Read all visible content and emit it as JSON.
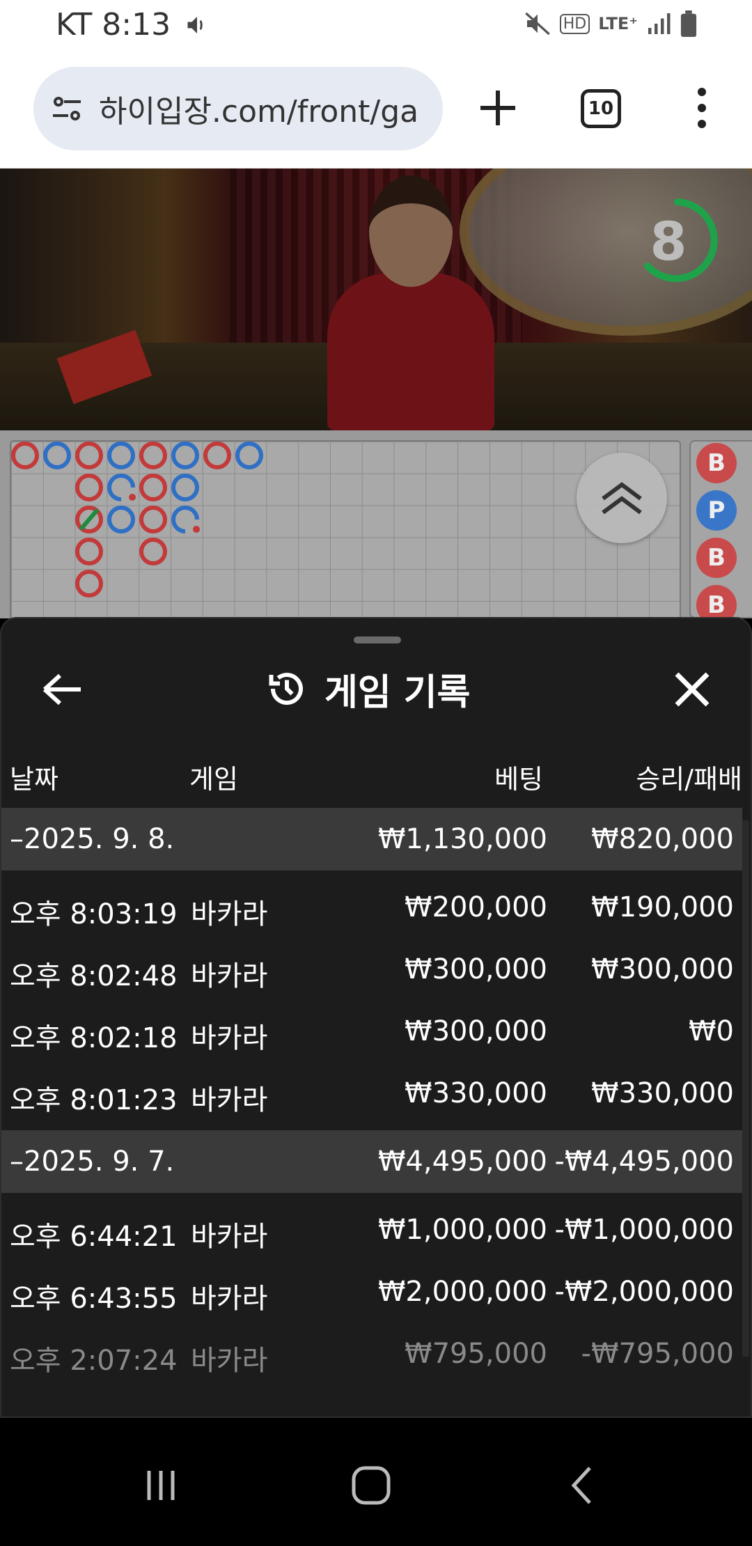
{
  "status_bar": {
    "carrier_time": "KT 8:13",
    "icons": [
      "volume-icon",
      "mute-icon",
      "hd-icon",
      "lte-icon",
      "signal-icon",
      "battery-icon"
    ],
    "network": "LTE⁺",
    "hd": "HD"
  },
  "browser": {
    "url": "하이입장.com/front/ga",
    "tab_count": "10"
  },
  "video": {
    "countdown": "8",
    "timer_color": "#1fa34a"
  },
  "roadmap": {
    "colors": {
      "banker": "#c23a3a",
      "player": "#2f6fc4",
      "tie": "#1e8a3c"
    },
    "side_beads": [
      {
        "label": "B",
        "color": "#c94a4a"
      },
      {
        "label": "P",
        "color": "#3a76c8"
      },
      {
        "label": "B",
        "color": "#c94a4a"
      },
      {
        "label": "B",
        "color": "#c94a4a"
      }
    ]
  },
  "sheet": {
    "title": "게임 기록",
    "columns": {
      "date": "날짜",
      "game": "게임",
      "bet": "베팅",
      "win_loss": "승리/패배"
    },
    "groups": [
      {
        "date": "–2025. 9. 8.",
        "bet": "₩1,130,000",
        "win_loss": "₩820,000",
        "rows": [
          {
            "time": "오후 8:03:19",
            "game": "바카라",
            "bet": "₩200,000",
            "win_loss": "₩190,000"
          },
          {
            "time": "오후 8:02:48",
            "game": "바카라",
            "bet": "₩300,000",
            "win_loss": "₩300,000"
          },
          {
            "time": "오후 8:02:18",
            "game": "바카라",
            "bet": "₩300,000",
            "win_loss": "₩0"
          },
          {
            "time": "오후 8:01:23",
            "game": "바카라",
            "bet": "₩330,000",
            "win_loss": "₩330,000"
          }
        ]
      },
      {
        "date": "–2025. 9. 7.",
        "bet": "₩4,495,000",
        "win_loss": "-₩4,495,000",
        "rows": [
          {
            "time": "오후 6:44:21",
            "game": "바카라",
            "bet": "₩1,000,000",
            "win_loss": "-₩1,000,000"
          },
          {
            "time": "오후 6:43:55",
            "game": "바카라",
            "bet": "₩2,000,000",
            "win_loss": "-₩2,000,000"
          },
          {
            "time": "오후 2:07:24",
            "game": "바카라",
            "bet": "₩795,000",
            "win_loss": "-₩795,000"
          }
        ]
      }
    ]
  }
}
